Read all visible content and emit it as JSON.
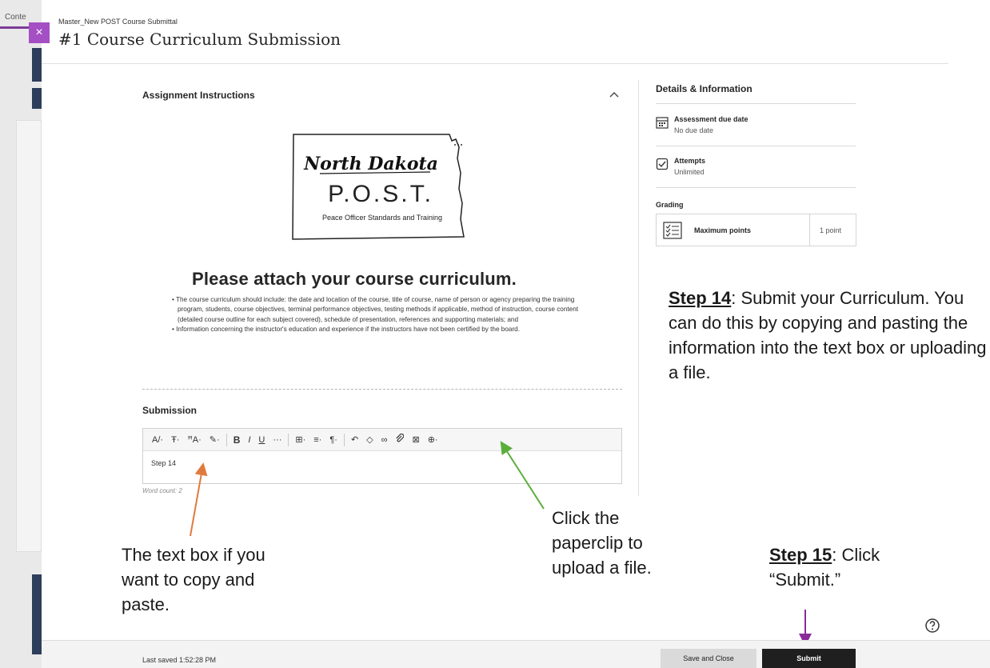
{
  "background": {
    "tab_label": "Conte"
  },
  "header": {
    "close_icon": "×",
    "breadcrumb": "Master_New POST Course Submittal",
    "title": "#1 Course Curriculum Submission"
  },
  "instructions": {
    "title": "Assignment Instructions",
    "collapse_icon": "chevron-up-icon",
    "logo": {
      "state": "North Dakota",
      "acronym": "P.O.S.T.",
      "subtitle": "Peace Officer Standards and Training"
    },
    "heading": "Please attach your course curriculum.",
    "bullets": [
      "The course curriculum should include: the date and location of the course, title of course, name of person or agency preparing the training program, students, course objectives, terminal performance objectives, testing methods if applicable, method of instruction, course content (detailed course outline for each subject covered), schedule of presentation, references and supporting materials; and",
      "Information concerning the instructor's education and experience if the instructors have not been certified by the board."
    ]
  },
  "submission": {
    "title": "Submission",
    "toolbar": [
      "text-style",
      "paragraph-style",
      "font-size",
      "text-color",
      "bold",
      "italic",
      "underline",
      "more",
      "table",
      "align",
      "paragraph",
      "undo",
      "clear-format",
      "link",
      "attach",
      "image",
      "insert"
    ],
    "text": "Step 14",
    "word_count": "Word count: 2"
  },
  "details": {
    "title": "Details & Information",
    "due_label": "Assessment due date",
    "due_value": "No due date",
    "attempts_label": "Attempts",
    "attempts_value": "Unlimited",
    "grading_label": "Grading",
    "grading_name": "Maximum points",
    "grading_value": "1 point"
  },
  "annotations": {
    "step14_label": "Step 14",
    "step14_text": ": Submit your Curriculum. You can do this by copying and pasting the information into the text box or uploading a file.",
    "paperclip_text": "Click the paperclip to upload a file.",
    "textbox_text": "The text box if you want to copy and paste.",
    "step15_label": "Step 15",
    "step15_text": ": Click “Submit.”"
  },
  "footer": {
    "last_saved": "Last saved 1:52:28 PM",
    "save_close_label": "Save and Close",
    "submit_label": "Submit"
  },
  "colors": {
    "accent_purple": "#a44fc4",
    "arrow_orange": "#e07a3c",
    "arrow_green": "#5aae3a",
    "arrow_purple": "#8a2b9a",
    "submit_bg": "#1f1f1f"
  }
}
